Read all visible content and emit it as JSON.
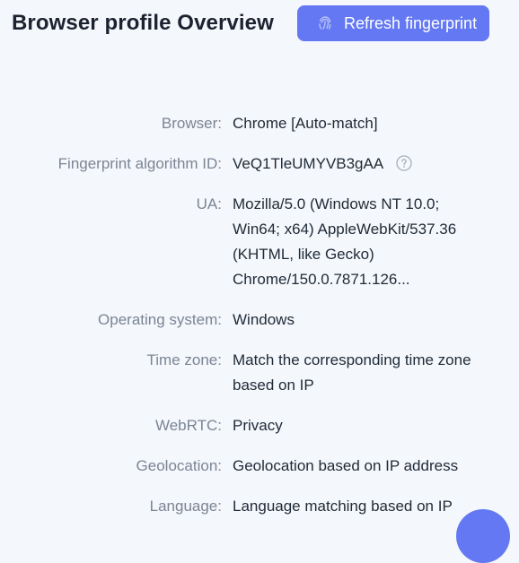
{
  "header": {
    "title": "Browser profile Overview",
    "refresh_label": "Refresh fingerprint"
  },
  "details": {
    "browser": {
      "label": "Browser:",
      "value": "Chrome [Auto-match]"
    },
    "fingerprint": {
      "label": "Fingerprint algorithm ID:",
      "value": "VeQ1TleUMYVB3gAA"
    },
    "ua": {
      "label": "UA:",
      "value": "Mozilla/5.0 (Windows NT 10.0; Win64; x64) AppleWebKit/537.36 (KHTML, like Gecko) Chrome/150.0.7871.126..."
    },
    "os": {
      "label": "Operating system:",
      "value": "Windows"
    },
    "timezone": {
      "label": "Time zone:",
      "value": "Match the corresponding time zone based on IP"
    },
    "webrtc": {
      "label": "WebRTC:",
      "value": "Privacy"
    },
    "geolocation": {
      "label": "Geolocation:",
      "value": "Geolocation based on IP address"
    },
    "language": {
      "label": "Language:",
      "value": "Language matching based on IP"
    }
  },
  "icons": {
    "refresh": "fingerprint-icon",
    "help": "question-circle-icon"
  },
  "colors": {
    "accent": "#6378f2",
    "background": "#f4f7fb",
    "label": "#7b8595",
    "value": "#1f2a37"
  }
}
